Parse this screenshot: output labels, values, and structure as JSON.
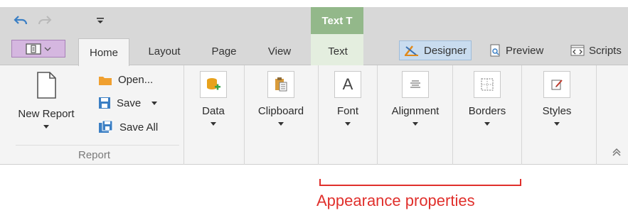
{
  "context_tab_header": "Text T",
  "tabs": [
    {
      "label": "Home",
      "active": true
    },
    {
      "label": "Layout"
    },
    {
      "label": "Page"
    },
    {
      "label": "View"
    },
    {
      "label": "Text"
    }
  ],
  "view_modes": {
    "designer": "Designer",
    "preview": "Preview",
    "scripts": "Scripts"
  },
  "report_group": {
    "new_report": "New Report",
    "open": "Open...",
    "save": "Save",
    "save_all": "Save All",
    "group_label": "Report"
  },
  "groups": {
    "data": "Data",
    "clipboard": "Clipboard",
    "font": "Font",
    "alignment": "Alignment",
    "borders": "Borders",
    "styles": "Styles"
  },
  "font_glyph": "A",
  "annotation": "Appearance properties",
  "colors": {
    "context_green": "#93b88a",
    "app_button": "#d5b7e0",
    "annotation_red": "#e0302c",
    "folder_orange": "#f0a030",
    "save_blue": "#3b7fc4"
  }
}
